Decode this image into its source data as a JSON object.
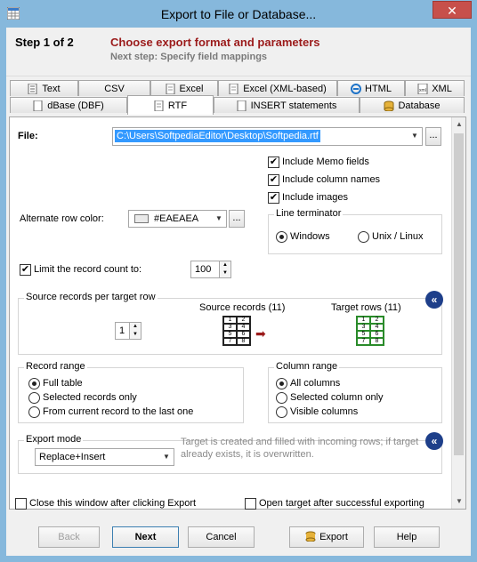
{
  "window": {
    "title": "Export to File or Database...",
    "close_glyph": "✕"
  },
  "header": {
    "step_label": "Step 1 of 2",
    "step_title": "Choose export format and parameters",
    "next_step": "Next step: Specify field mappings"
  },
  "tabs_row1": [
    {
      "label": "Text",
      "icon": "text-file-icon"
    },
    {
      "label": "CSV",
      "icon": ""
    },
    {
      "label": "Excel",
      "icon": "excel-file-icon"
    },
    {
      "label": "Excel (XML-based)",
      "icon": "excel-file-icon"
    },
    {
      "label": "HTML",
      "icon": "ie-icon"
    },
    {
      "label": "XML",
      "icon": "xml-file-icon"
    }
  ],
  "tabs_row2": [
    {
      "label": "dBase (DBF)",
      "icon": "dbf-file-icon"
    },
    {
      "label": "RTF",
      "icon": "rtf-file-icon",
      "active": true
    },
    {
      "label": "INSERT statements",
      "icon": "sql-file-icon"
    },
    {
      "label": "Database",
      "icon": "database-icon"
    }
  ],
  "file": {
    "label": "File:",
    "value": "C:\\Users\\SoftpediaEditor\\Desktop\\Softpedia.rtf",
    "browse": "..."
  },
  "options": {
    "include_memo": {
      "label": "Include Memo fields",
      "checked": true
    },
    "include_columns": {
      "label": "Include column names",
      "checked": true
    },
    "include_images": {
      "label": "Include images",
      "checked": true
    }
  },
  "alt_row": {
    "label": "Alternate row color:",
    "value": "#EAEAEA",
    "color": "#EAEAEA",
    "browse": "..."
  },
  "line_term": {
    "title": "Line terminator",
    "windows": "Windows",
    "unix": "Unix / Linux",
    "selected": "windows"
  },
  "limit": {
    "label": "Limit the record count to:",
    "checked": true,
    "value": "100"
  },
  "source_records": {
    "title": "Source records per target row",
    "count": "1",
    "source_label": "Source records (11)",
    "target_label": "Target rows (11)",
    "grid_cells": [
      "1",
      "2",
      "3",
      "4",
      "5",
      "6",
      "7",
      "8"
    ]
  },
  "record_range": {
    "title": "Record range",
    "full": "Full table",
    "selected": "Selected records only",
    "from_current": "From current record to the last one",
    "value": "full"
  },
  "column_range": {
    "title": "Column range",
    "all": "All columns",
    "selected": "Selected column only",
    "visible": "Visible columns",
    "value": "all"
  },
  "export_mode": {
    "title": "Export mode",
    "value": "Replace+Insert",
    "hint": "Target is created and filled with incoming rows; if target already exists, it is overwritten."
  },
  "footer": {
    "close_after": {
      "label": "Close this window after clicking Export",
      "checked": false
    },
    "open_target": {
      "label": "Open target after successful exporting",
      "checked": false
    },
    "back": "Back",
    "next": "Next",
    "cancel": "Cancel",
    "export": "Export",
    "help": "Help"
  },
  "colors": {
    "title_bg": "#86b8dc",
    "accent_red": "#9b1b1b",
    "file_select": "#3399ff"
  }
}
